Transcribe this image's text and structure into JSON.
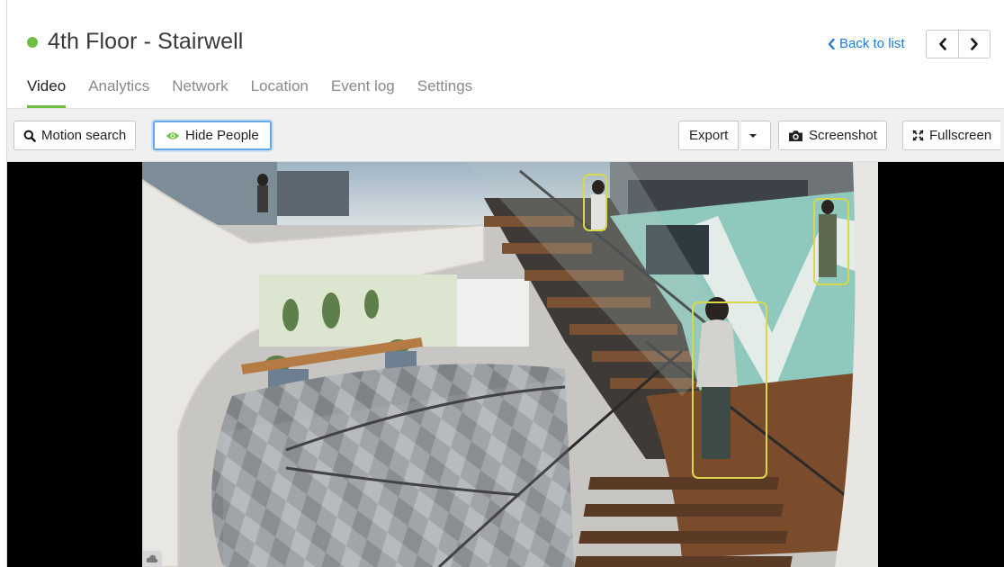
{
  "camera": {
    "title": "4th Floor - Stairwell",
    "status_color": "#6ebe44"
  },
  "nav": {
    "back_label": "Back to list",
    "prev_icon": "chevron-left-icon",
    "next_icon": "chevron-right-icon"
  },
  "tabs": [
    {
      "label": "Video",
      "active": true
    },
    {
      "label": "Analytics",
      "active": false
    },
    {
      "label": "Network",
      "active": false
    },
    {
      "label": "Location",
      "active": false
    },
    {
      "label": "Event log",
      "active": false
    },
    {
      "label": "Settings",
      "active": false
    }
  ],
  "toolbar": {
    "motion_search_label": "Motion search",
    "hide_people_label": "Hide People",
    "export_label": "Export",
    "screenshot_label": "Screenshot",
    "fullscreen_label": "Fullscreen"
  },
  "video": {
    "detections": [
      {
        "label": "person"
      },
      {
        "label": "person"
      },
      {
        "label": "person"
      }
    ],
    "box_color": "#d8d84a"
  },
  "colors": {
    "accent_green": "#6ebe44",
    "link_blue": "#1f7ad6",
    "focus_blue": "#62a8e8"
  }
}
